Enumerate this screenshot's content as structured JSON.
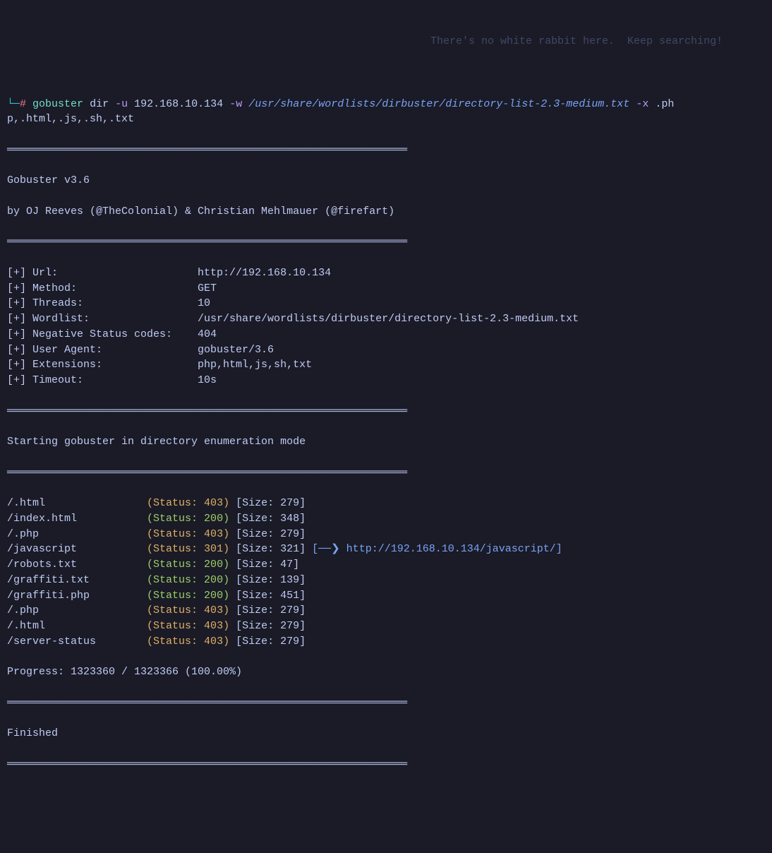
{
  "command": {
    "prompt_marker": "└─",
    "hash": "#",
    "binary": "gobuster",
    "subcommand": "dir",
    "flag_u": "-u",
    "target": "192.168.10.134",
    "flag_w": "-w",
    "wordlist": "/usr/share/wordlists/dirbuster/directory-list-2.3-medium.txt",
    "flag_x": "-x",
    "extensions_line1": ".ph",
    "extensions_line2": "p,.html,.js,.sh,.txt"
  },
  "ghost": "There's no white rabbit here.  Keep searching!",
  "divider": "═══════════════════════════════════════════════════════════════",
  "header": {
    "version": "Gobuster v3.6",
    "credits": "by OJ Reeves (@TheColonial) & Christian Mehlmauer (@firefart)"
  },
  "config": [
    {
      "label": "[+] Url:",
      "value": "http://192.168.10.134"
    },
    {
      "label": "[+] Method:",
      "value": "GET"
    },
    {
      "label": "[+] Threads:",
      "value": "10"
    },
    {
      "label": "[+] Wordlist:",
      "value": "/usr/share/wordlists/dirbuster/directory-list-2.3-medium.txt"
    },
    {
      "label": "[+] Negative Status codes:",
      "value": "404"
    },
    {
      "label": "[+] User Agent:",
      "value": "gobuster/3.6"
    },
    {
      "label": "[+] Extensions:",
      "value": "php,html,js,sh,txt"
    },
    {
      "label": "[+] Timeout:",
      "value": "10s"
    }
  ],
  "starting": "Starting gobuster in directory enumeration mode",
  "results": [
    {
      "path": "/.html",
      "status": "(Status: 403)",
      "color": "yellow",
      "size": "[Size: 279]",
      "redirect": ""
    },
    {
      "path": "/index.html",
      "status": "(Status: 200)",
      "color": "green",
      "size": "[Size: 348]",
      "redirect": ""
    },
    {
      "path": "/.php",
      "status": "(Status: 403)",
      "color": "yellow",
      "size": "[Size: 279]",
      "redirect": ""
    },
    {
      "path": "/javascript",
      "status": "(Status: 301)",
      "color": "yellow",
      "size": "[Size: 321]",
      "redirect": "[──❯ http://192.168.10.134/javascript/]"
    },
    {
      "path": "/robots.txt",
      "status": "(Status: 200)",
      "color": "green",
      "size": "[Size: 47]",
      "redirect": ""
    },
    {
      "path": "/graffiti.txt",
      "status": "(Status: 200)",
      "color": "green",
      "size": "[Size: 139]",
      "redirect": ""
    },
    {
      "path": "/graffiti.php",
      "status": "(Status: 200)",
      "color": "green",
      "size": "[Size: 451]",
      "redirect": ""
    },
    {
      "path": "/.php",
      "status": "(Status: 403)",
      "color": "yellow",
      "size": "[Size: 279]",
      "redirect": ""
    },
    {
      "path": "/.html",
      "status": "(Status: 403)",
      "color": "yellow",
      "size": "[Size: 279]",
      "redirect": ""
    },
    {
      "path": "/server-status",
      "status": "(Status: 403)",
      "color": "yellow",
      "size": "[Size: 279]",
      "redirect": ""
    }
  ],
  "progress": "Progress: 1323360 / 1323366 (100.00%)",
  "finished": "Finished"
}
